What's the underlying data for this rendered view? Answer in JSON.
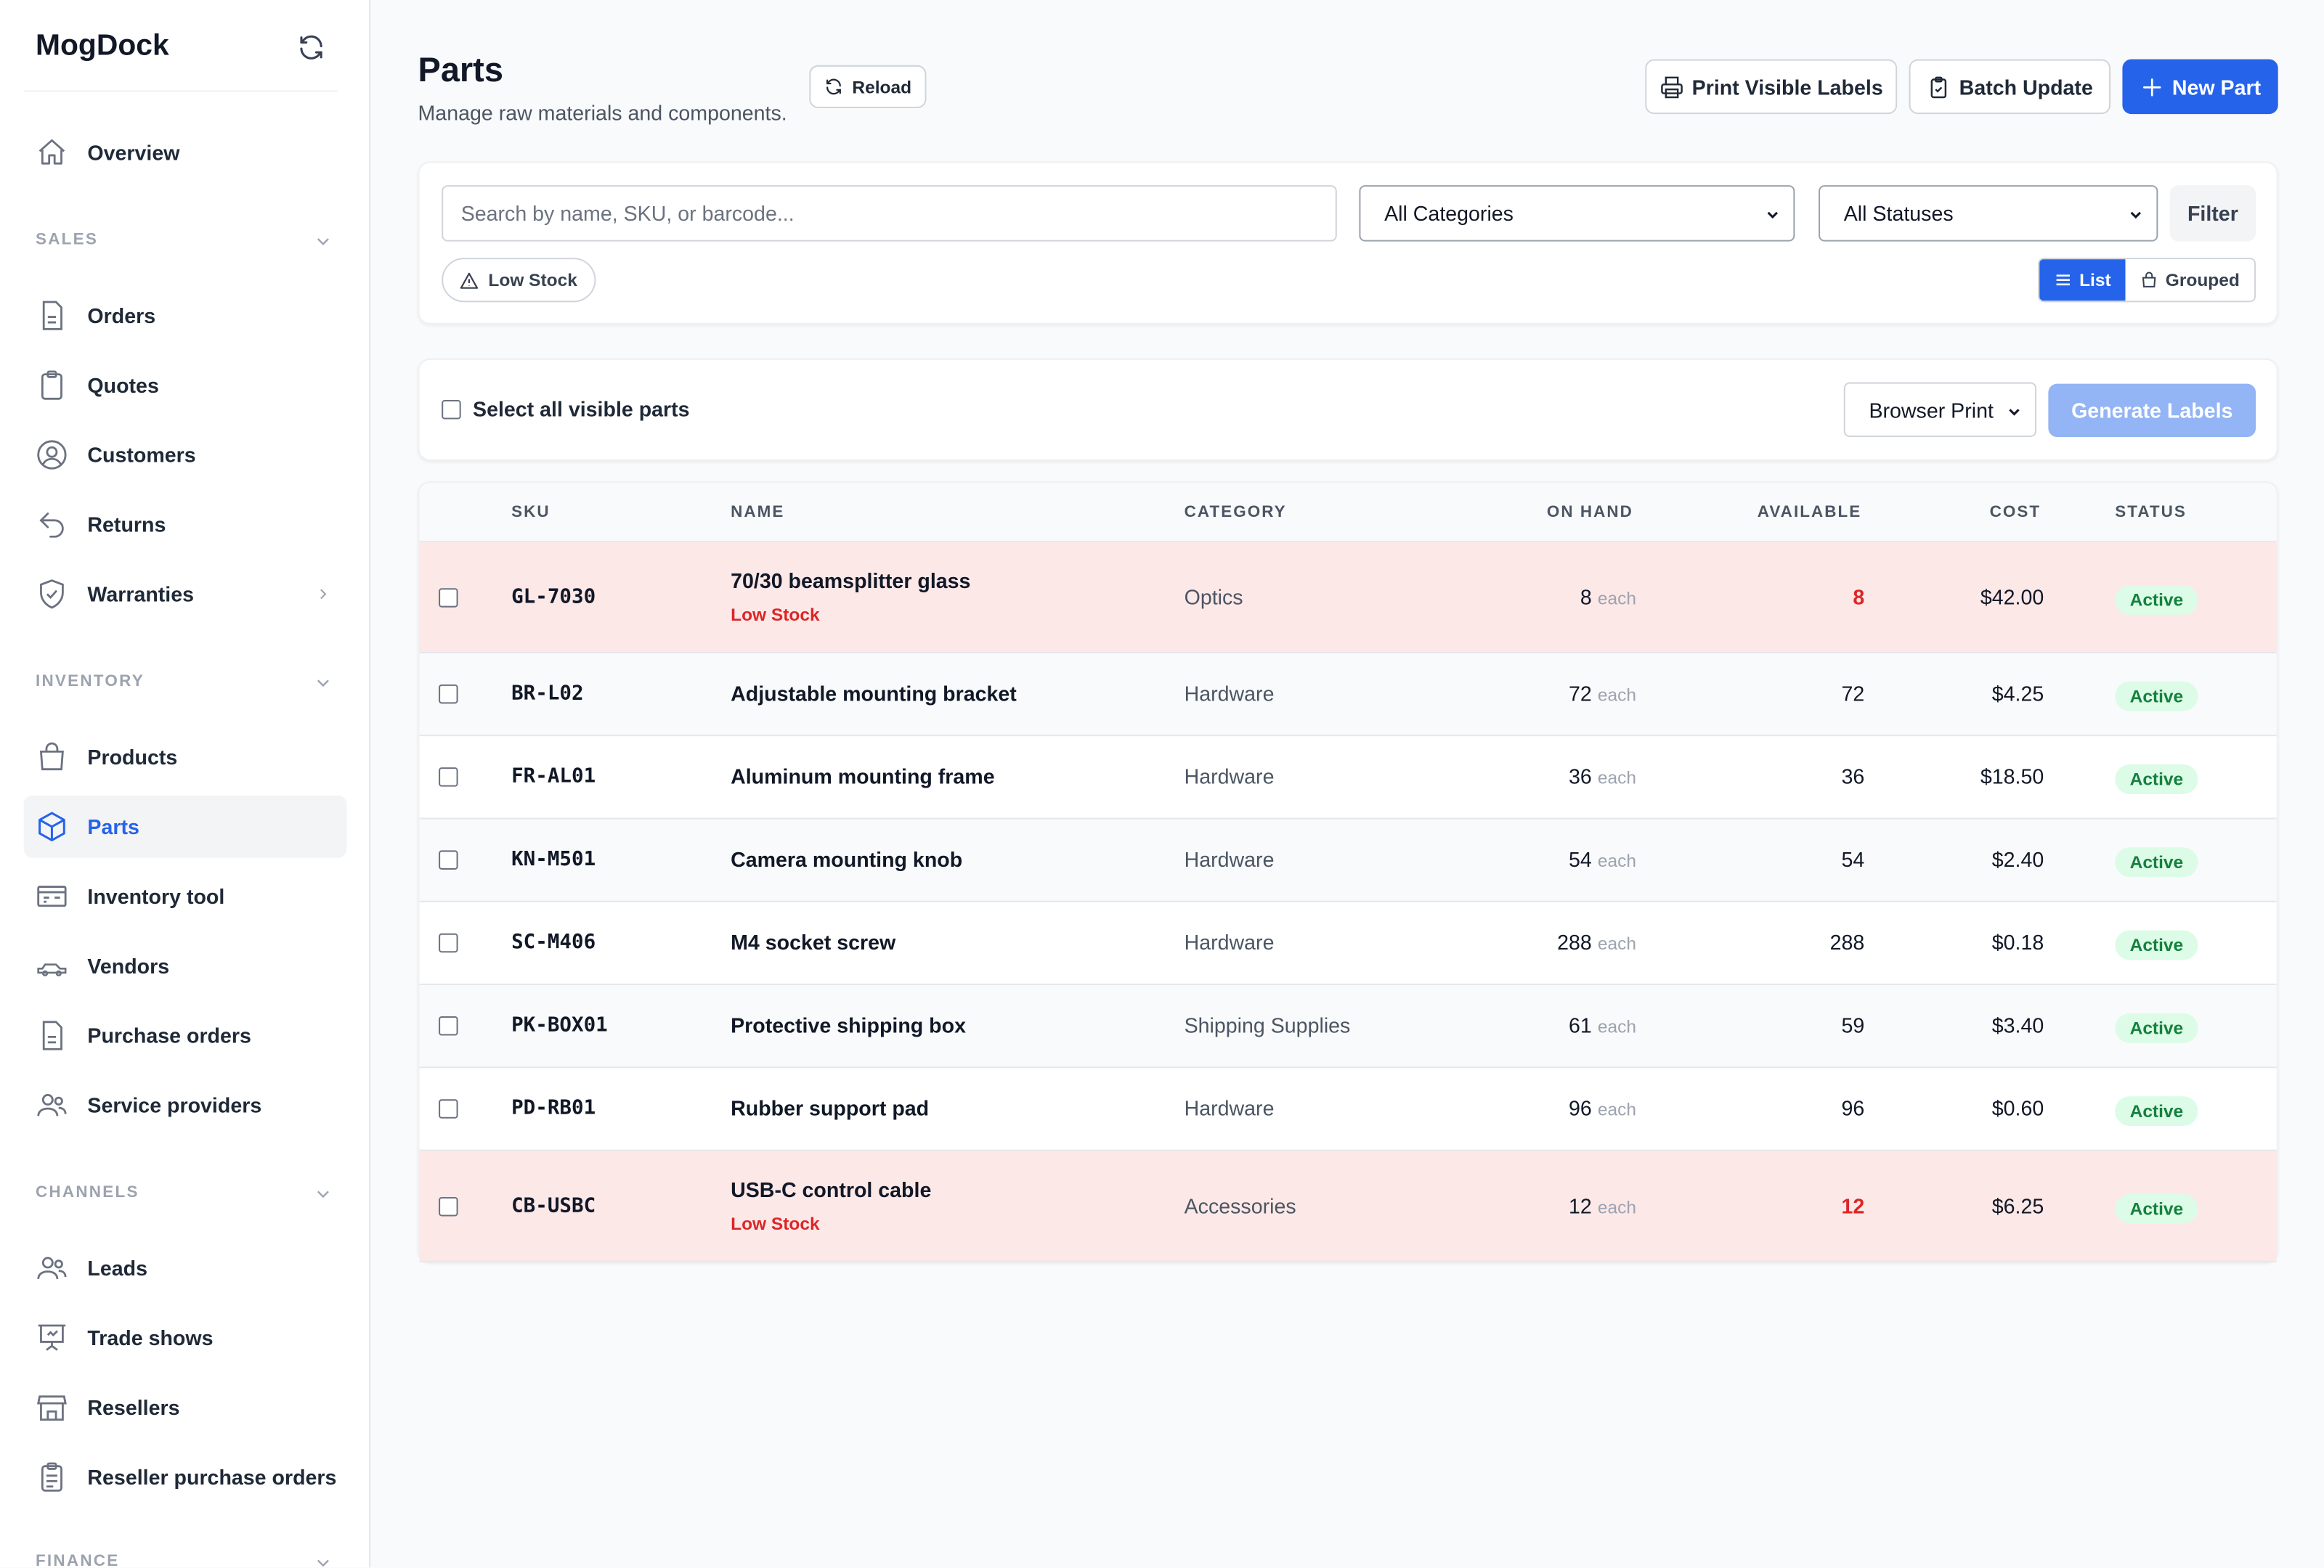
{
  "app": {
    "name": "MogDock"
  },
  "sidebar": {
    "overview": "Overview",
    "sections": [
      {
        "label": "SALES"
      },
      {
        "label": "INVENTORY"
      },
      {
        "label": "CHANNELS"
      },
      {
        "label": "FINANCE"
      }
    ],
    "sales": [
      "Orders",
      "Quotes",
      "Customers",
      "Returns",
      "Warranties"
    ],
    "inventory": [
      "Products",
      "Parts",
      "Inventory tool",
      "Vendors",
      "Purchase orders",
      "Service providers"
    ],
    "channels": [
      "Leads",
      "Trade shows",
      "Resellers",
      "Reseller purchase orders"
    ],
    "active": "Parts"
  },
  "header": {
    "title": "Parts",
    "subtitle": "Manage raw materials and components.",
    "reload": "Reload",
    "print_labels": "Print Visible Labels",
    "batch_update": "Batch Update",
    "new_part": "New Part"
  },
  "filters": {
    "search_placeholder": "Search by name, SKU, or barcode...",
    "category": "All Categories",
    "status": "All Statuses",
    "filter": "Filter",
    "low_stock": "Low Stock",
    "view_list": "List",
    "view_grouped": "Grouped",
    "active_view": "List"
  },
  "labels_bar": {
    "select_all": "Select all visible parts",
    "print_mode": "Browser Print",
    "generate": "Generate Labels"
  },
  "table": {
    "columns": [
      "SKU",
      "NAME",
      "CATEGORY",
      "ON HAND",
      "AVAILABLE",
      "COST",
      "STATUS"
    ],
    "unit": "each",
    "low_stock_label": "Low Stock",
    "rows": [
      {
        "sku": "GL-7030",
        "name": "70/30 beamsplitter glass",
        "category": "Optics",
        "on_hand": "8",
        "available": "8",
        "cost": "$42.00",
        "status": "Active",
        "low_stock": true
      },
      {
        "sku": "BR-L02",
        "name": "Adjustable mounting bracket",
        "category": "Hardware",
        "on_hand": "72",
        "available": "72",
        "cost": "$4.25",
        "status": "Active",
        "low_stock": false
      },
      {
        "sku": "FR-AL01",
        "name": "Aluminum mounting frame",
        "category": "Hardware",
        "on_hand": "36",
        "available": "36",
        "cost": "$18.50",
        "status": "Active",
        "low_stock": false
      },
      {
        "sku": "KN-M501",
        "name": "Camera mounting knob",
        "category": "Hardware",
        "on_hand": "54",
        "available": "54",
        "cost": "$2.40",
        "status": "Active",
        "low_stock": false
      },
      {
        "sku": "SC-M406",
        "name": "M4 socket screw",
        "category": "Hardware",
        "on_hand": "288",
        "available": "288",
        "cost": "$0.18",
        "status": "Active",
        "low_stock": false
      },
      {
        "sku": "PK-BOX01",
        "name": "Protective shipping box",
        "category": "Shipping Supplies",
        "on_hand": "61",
        "available": "59",
        "cost": "$3.40",
        "status": "Active",
        "low_stock": false
      },
      {
        "sku": "PD-RB01",
        "name": "Rubber support pad",
        "category": "Hardware",
        "on_hand": "96",
        "available": "96",
        "cost": "$0.60",
        "status": "Active",
        "low_stock": false
      },
      {
        "sku": "CB-USBC",
        "name": "USB-C control cable",
        "category": "Accessories",
        "on_hand": "12",
        "available": "12",
        "cost": "$6.25",
        "status": "Active",
        "low_stock": true
      }
    ]
  },
  "colors": {
    "accent": "#2563eb",
    "low_stock_row": "#fde8e8",
    "alt_row": "#f9fafb",
    "badge_bg": "#dcfce7",
    "badge_text": "#15803d",
    "danger": "#dc2626"
  }
}
